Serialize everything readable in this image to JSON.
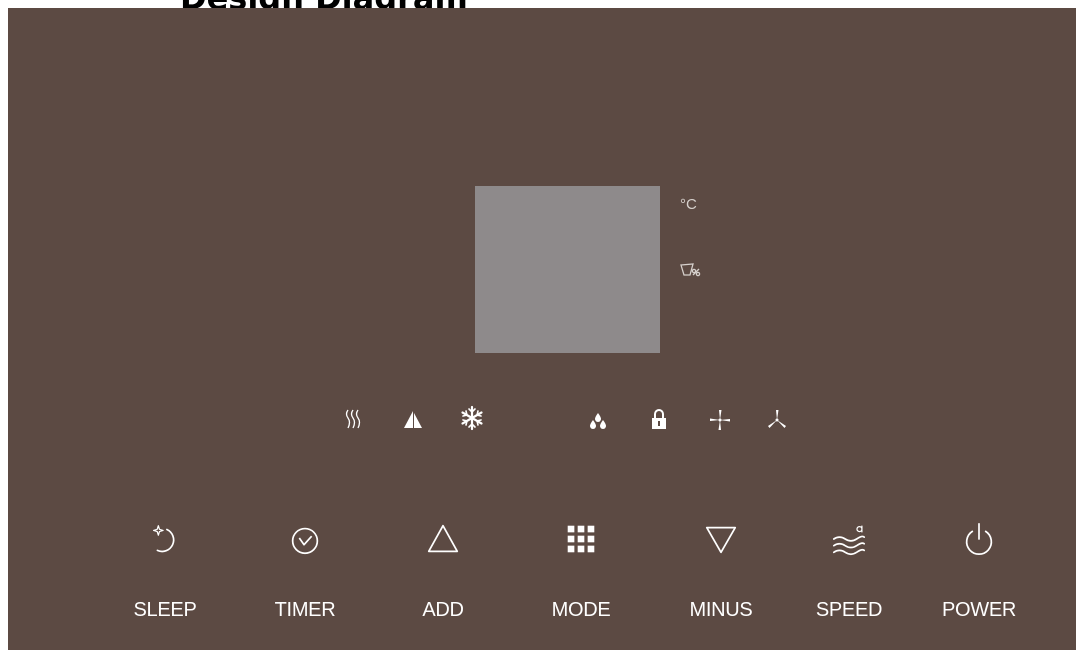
{
  "heading": {
    "title": "Design Diagram"
  },
  "colors": {
    "panel": "#5c4a43",
    "display": "#8e8a8b",
    "icon": "#ffffff",
    "indicator": "#d6d0cc"
  },
  "display": {
    "temperature_unit": "°C",
    "humidity_icon": "humidity-percent-icon"
  },
  "indicators": [
    {
      "name": "heat-icon"
    },
    {
      "name": "dry-icon"
    },
    {
      "name": "cool-icon"
    },
    {
      "name": "water-icon"
    },
    {
      "name": "lock-icon"
    },
    {
      "name": "fan-high-icon"
    },
    {
      "name": "fan-low-icon"
    }
  ],
  "buttons": [
    {
      "label": "SLEEP",
      "icon": "sleep-icon"
    },
    {
      "label": "TIMER",
      "icon": "timer-icon"
    },
    {
      "label": "ADD",
      "icon": "up-triangle-icon"
    },
    {
      "label": "MODE",
      "icon": "grid-icon"
    },
    {
      "label": "MINUS",
      "icon": "down-triangle-icon"
    },
    {
      "label": "SPEED",
      "icon": "wind-speed-icon"
    },
    {
      "label": "POWER",
      "icon": "power-icon"
    }
  ]
}
